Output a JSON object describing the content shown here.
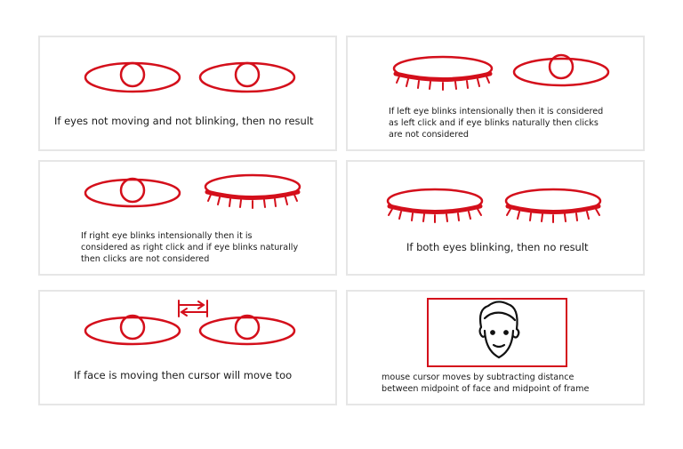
{
  "panels": {
    "no_movement": {
      "caption": "If eyes not moving and not blinking, then no result"
    },
    "left_blink": {
      "lines": [
        "If left eye blinks intensionally then it is considered",
        "as left click and if eye blinks naturally then clicks",
        "are not considered"
      ]
    },
    "right_blink": {
      "lines": [
        "If right eye blinks intensionally then it is",
        "considered as right click and if eye blinks naturally",
        "then clicks are not considered"
      ]
    },
    "both_blink": {
      "caption": "If both eyes blinking, then no result"
    },
    "face_moving": {
      "caption": "If face is moving then cursor will move too"
    },
    "cursor_calc": {
      "lines": [
        "mouse cursor moves by subtracting distance",
        "between midpoint of face and midpoint of frame"
      ]
    }
  },
  "colors": {
    "accent": "#d40f1b",
    "text": "#1a1a1a",
    "panel_border": "#e6e6e6"
  }
}
